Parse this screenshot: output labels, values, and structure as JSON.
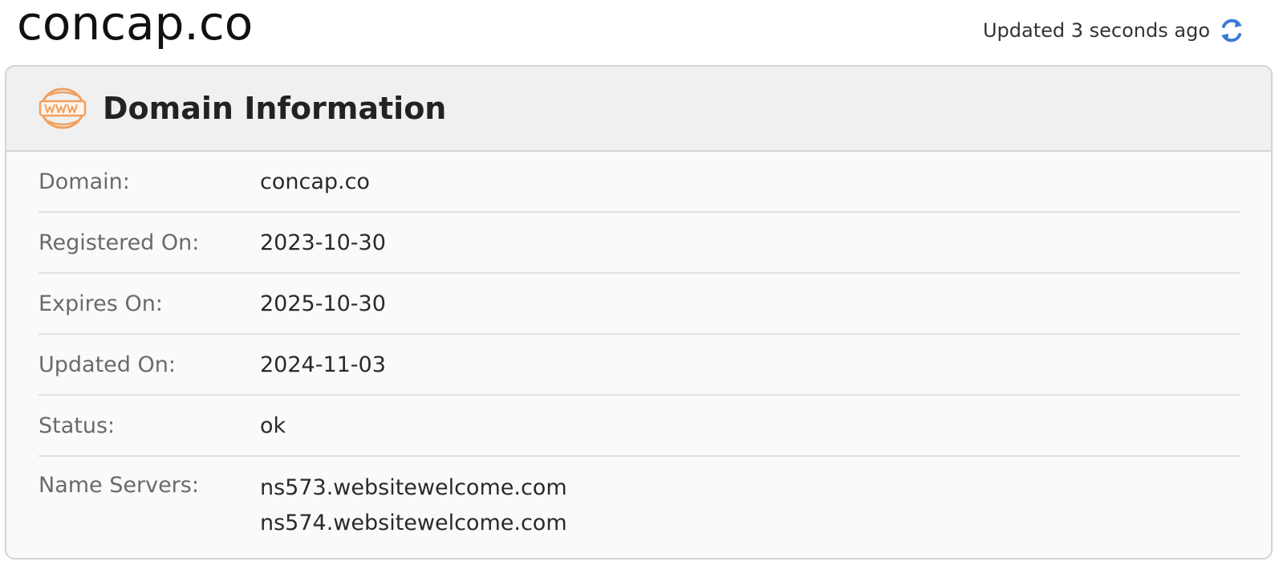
{
  "header": {
    "site_title": "concap.co",
    "updated_text": "Updated 3 seconds ago",
    "refresh_icon": "refresh-icon"
  },
  "card": {
    "title": "Domain Information",
    "icon": "www-globe-icon",
    "rows": [
      {
        "label": "Domain:",
        "value": "concap.co"
      },
      {
        "label": "Registered On:",
        "value": "2023-10-30"
      },
      {
        "label": "Expires On:",
        "value": "2025-10-30"
      },
      {
        "label": "Updated On:",
        "value": "2024-11-03"
      },
      {
        "label": "Status:",
        "value": "ok"
      }
    ],
    "name_servers": {
      "label": "Name Servers:",
      "values": [
        "ns573.websitewelcome.com",
        "ns574.websitewelcome.com"
      ]
    }
  },
  "colors": {
    "accent_icon": "#f0a060",
    "refresh_blue": "#3a7bd5",
    "header_bg": "#f0f0f0",
    "card_bg": "#fafafa"
  }
}
